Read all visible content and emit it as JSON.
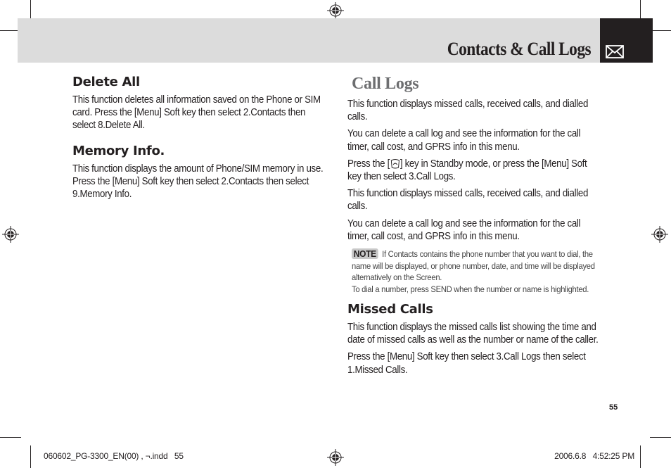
{
  "header": {
    "title": "Contacts & Call Logs",
    "tab_icon": "envelope-icon"
  },
  "left_column": {
    "sections": [
      {
        "heading": "Delete All",
        "body": "This function deletes all information saved on the Phone or SIM card. Press the [Menu] Soft key then select 2.Contacts then select 8.Delete All."
      },
      {
        "heading": "Memory Info.",
        "body": "This function displays the amount of Phone/SIM memory in use. Press the [Menu] Soft key then select 2.Contacts then select 9.Memory Info."
      }
    ]
  },
  "right_column": {
    "title": "Call Logs",
    "paragraphs": [
      "This function displays missed calls, received calls, and dialled calls.",
      "You can delete a call log and see the information for the call timer, call cost, and GPRS info in this menu."
    ],
    "press_key": {
      "before": "Press the [",
      "icon": "send-key-icon",
      "after": "] key in Standby mode, or press the [Menu] Soft key then select 3.Call Logs."
    },
    "paragraphs_2": [
      "This function displays missed calls, received calls, and dialled calls.",
      "You can delete a call log and see the information for the call timer, call cost, and GPRS info in this menu."
    ],
    "note": {
      "badge": "NOTE",
      "line1": "If Contacts contains the phone number that you want to dial, the name will be displayed, or phone number, date, and time will be displayed alternatively on the Screen.",
      "line2": "To dial a number, press SEND when the number or name is highlighted."
    },
    "missed_calls": {
      "heading": "Missed Calls",
      "paragraphs": [
        "This function displays the missed calls list showing the time and date of missed calls as well as the number or name of the caller.",
        "Press the [Menu] Soft key then select 3.Call Logs then select 1.Missed Calls."
      ]
    }
  },
  "page_number": "55",
  "footer": {
    "file": "060602_PG-3300_EN(00) , ¬.indd   55",
    "timestamp": "2006.6.8   4:52:25 PM"
  }
}
